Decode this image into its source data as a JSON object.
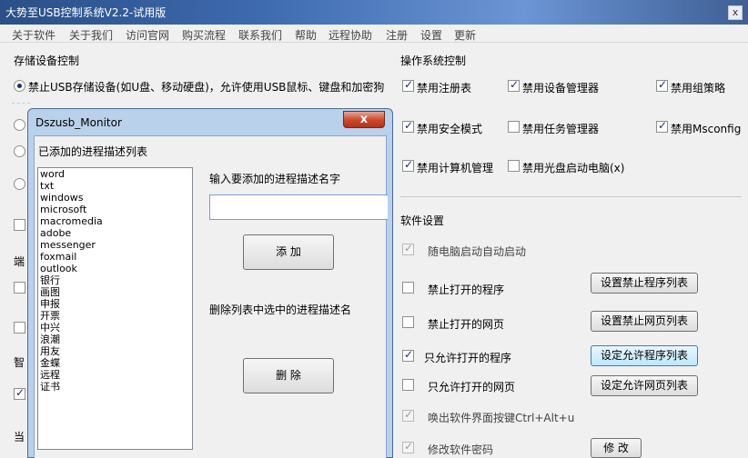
{
  "window": {
    "title": "大势至USB控制系统V2.2-试用版",
    "close_label": "x"
  },
  "menu": [
    "关于软件",
    "关于我们",
    "访问官网",
    "购买流程",
    "联系我们",
    "帮助",
    "远程协助",
    "注册",
    "设置",
    "更新"
  ],
  "storage": {
    "title": "存储设备控制",
    "option_selected": "禁止USB存储设备(如U盘、移动硬盘)，允许使用USB鼠标、键盘和加密狗"
  },
  "left_partial": [
    "端",
    "智",
    "当"
  ],
  "os_control": {
    "title": "操作系统控制",
    "items": [
      {
        "label": "禁用注册表",
        "checked": true
      },
      {
        "label": "禁用设备管理器",
        "checked": true
      },
      {
        "label": "禁用组策略",
        "checked": true
      },
      {
        "label": "禁用安全模式",
        "checked": true
      },
      {
        "label": "禁用任务管理器",
        "checked": false
      },
      {
        "label": "禁用Msconfig",
        "checked": true
      },
      {
        "label": "禁用计算机管理",
        "checked": true
      },
      {
        "label": "禁用光盘启动电脑(x)",
        "checked": false
      }
    ]
  },
  "software_settings": {
    "title": "软件设置",
    "items": [
      {
        "label": "随电脑启动自动启动",
        "checked": true,
        "disabled": true
      },
      {
        "label": "禁止打开的程序",
        "checked": false,
        "button": "设置禁止程序列表"
      },
      {
        "label": "禁止打开的网页",
        "checked": false,
        "button": "设置禁止网页列表"
      },
      {
        "label": "只允许打开的程序",
        "checked": true,
        "button": "设定允许程序列表"
      },
      {
        "label": "只允许打开的网页",
        "checked": false,
        "button": "设定允许网页列表"
      },
      {
        "label": "唤出软件界面按键Ctrl+Alt+u",
        "checked": true,
        "disabled": true
      },
      {
        "label": "修改软件密码",
        "checked": true,
        "disabled": true,
        "button": "修 改"
      }
    ]
  },
  "popup": {
    "title": "Dszusb_Monitor",
    "close_label": "x",
    "list_title": "已添加的进程描述列表",
    "list_items": [
      "word",
      "txt",
      "windows",
      "microsoft",
      "macromedia",
      "adobe",
      "messenger",
      "foxmail",
      "outlook",
      "银行",
      "画图",
      "申报",
      "开票",
      "中兴",
      "浪潮",
      "用友",
      "金蝶",
      "远程",
      "证书"
    ],
    "input_label": "输入要添加的进程描述名字",
    "input_value": "",
    "add_button": "添 加",
    "delete_label": "删除列表中选中的进程描述名",
    "delete_button": "删 除"
  }
}
